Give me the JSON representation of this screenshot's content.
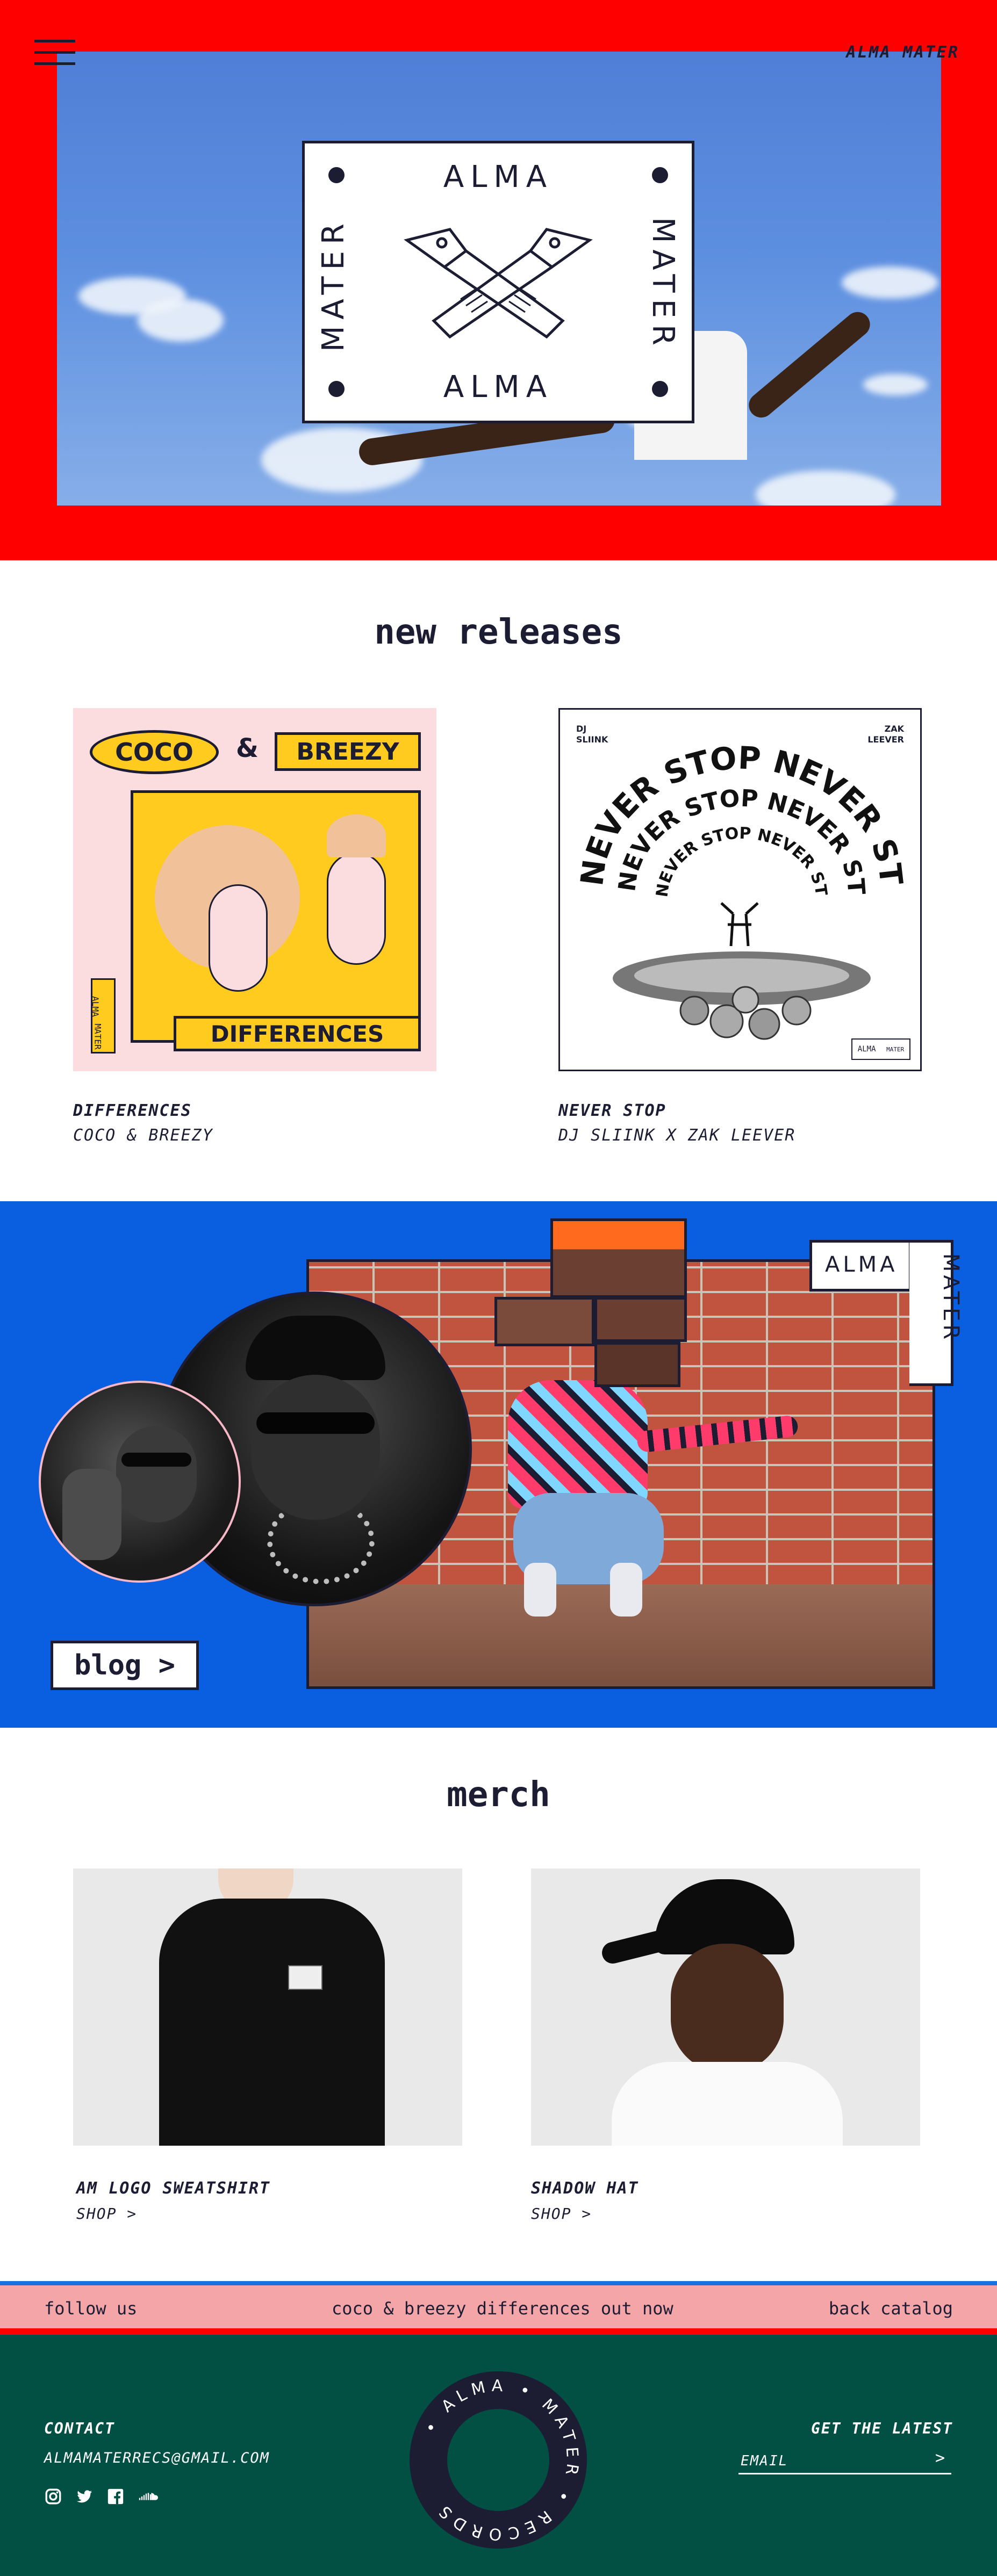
{
  "header": {
    "brand": "ALMA MATER",
    "menu_icon": "hamburger-menu-icon"
  },
  "hero": {
    "logo": {
      "top_word": "ALMA",
      "bottom_word": "ALMA",
      "left_word": "MATER",
      "right_word": "MATER"
    }
  },
  "new_releases": {
    "title": "new releases",
    "items": [
      {
        "title": "DIFFERENCES",
        "artist": "COCO & BREEZY",
        "cover": {
          "top_left": "COCO",
          "ampersand": "&",
          "top_right": "BREEZY",
          "bottom": "DIFFERENCES",
          "stamp_top": "ALMA",
          "stamp_bottom": "MATER"
        }
      },
      {
        "title": "NEVER STOP",
        "artist": "DJ SLIINK X ZAK LEEVER",
        "cover": {
          "left_credit_line1": "DJ",
          "left_credit_line2": "SLIINK",
          "right_credit_line1": "ZAK",
          "right_credit_line2": "LEEVER",
          "arc_text": "NEVER STOP NEVER STOP",
          "stamp_left": "ALMA",
          "stamp_right": "MATER"
        }
      }
    ]
  },
  "blog": {
    "button_label": "blog >",
    "badge_top": "ALMA",
    "badge_side": "MATER"
  },
  "merch": {
    "title": "merch",
    "items": [
      {
        "name": "AM LOGO SWEATSHIRT",
        "link": "SHOP >"
      },
      {
        "name": "SHADOW HAT",
        "link": "SHOP >"
      }
    ]
  },
  "ticker": {
    "left": "follow us",
    "center": "coco & breezy differences out now",
    "right": "back catalog"
  },
  "footer": {
    "contact_label": "CONTACT",
    "contact_email": "ALMAMATERRECS@GMAIL.COM",
    "social_icons": [
      "instagram-icon",
      "twitter-icon",
      "facebook-icon",
      "soundcloud-icon"
    ],
    "newsletter_label": "GET THE LATEST",
    "email_placeholder": "EMAIL",
    "submit_label": ">",
    "seal_text": "• ALMA • MATER • RECORDS"
  },
  "colors": {
    "hero_red": "#ff0000",
    "navy": "#1c1c33",
    "blog_blue": "#0a5fe0",
    "ticker_pink": "#f3a5a8",
    "footer_green": "#024f44",
    "cover_pink": "#fbdde0",
    "cover_yellow": "#ffcb1f"
  }
}
